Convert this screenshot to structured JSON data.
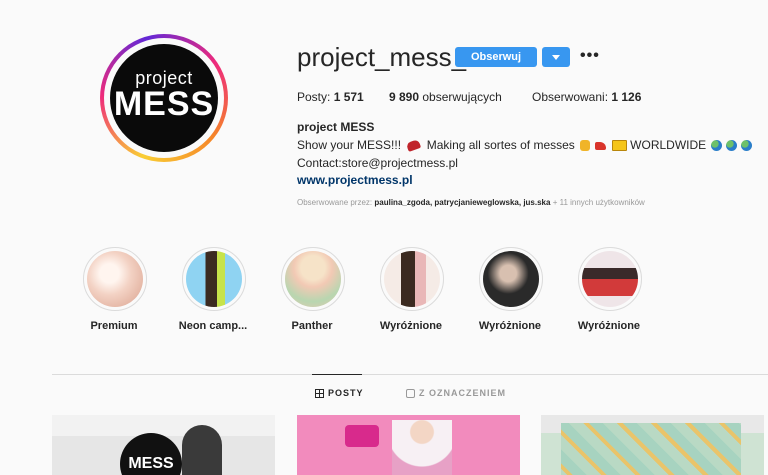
{
  "profile": {
    "avatar_top": "project",
    "avatar_main": "MESS",
    "username": "project_mess_",
    "follow_label": "Obserwuj",
    "more_glyph": "•••"
  },
  "stats": {
    "posts_label": "Posty:",
    "posts_value": "1 571",
    "followers_value": "9 890",
    "followers_label": "obserwujących",
    "following_label": "Obserwowani:",
    "following_value": "1 126"
  },
  "bio": {
    "name": "project MESS",
    "line1_start": "Show your MESS!!!",
    "line1_middle": "Making all sortes of messes",
    "line1_end": "WORLDWIDE",
    "line2": "Contact:store@projectmess.pl",
    "link": "www.projectmess.pl"
  },
  "followed_by": {
    "prefix": "Obserwowane przez:",
    "users": "paulina_zgoda, patrycjanieweglowska, jus.ska",
    "suffix": "+ 11 innych użytkowników"
  },
  "highlights": [
    {
      "label": "Premium",
      "color": "#f3d2c4"
    },
    {
      "label": "Neon camp...",
      "color": "#7bc6e8"
    },
    {
      "label": "Panther",
      "color": "#f2c9b4"
    },
    {
      "label": "Wyróżnione",
      "color": "#f1e5e0"
    },
    {
      "label": "Wyróżnione",
      "color": "#2a2a2a"
    },
    {
      "label": "Wyróżnione",
      "color": "#e9d4d8"
    }
  ],
  "tabs": {
    "posts": "POSTY",
    "tagged": "Z OZNACZENIEM"
  },
  "posts_preview": {
    "post1_text": "MESS"
  },
  "colors": {
    "accent": "#3897f0",
    "text": "#262626",
    "muted": "#999999",
    "link": "#003569"
  }
}
